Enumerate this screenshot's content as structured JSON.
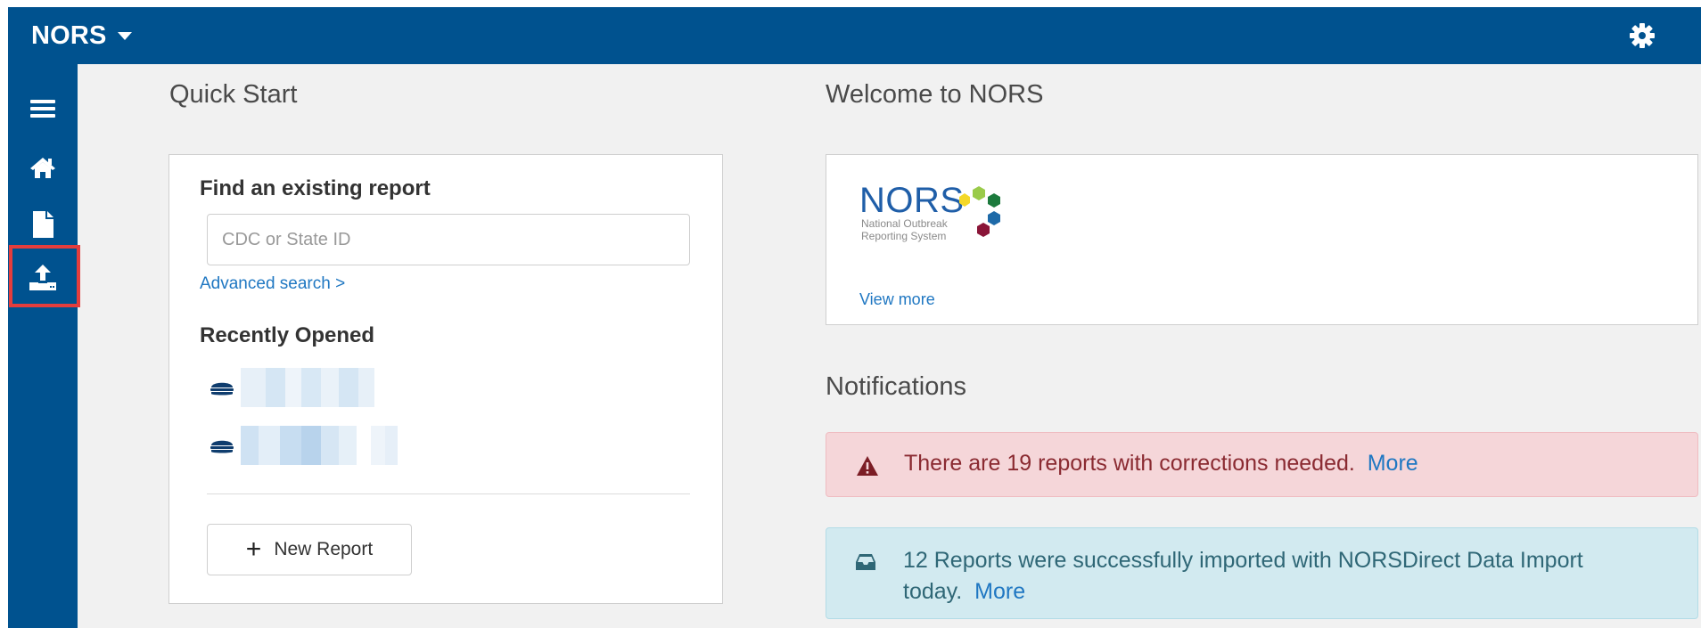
{
  "app": {
    "brand": "NORS"
  },
  "quick_start": {
    "title": "Quick Start",
    "find_heading": "Find an existing report",
    "search_placeholder": "CDC or State ID",
    "search_value": "",
    "advanced_link": "Advanced search >",
    "recent_heading": "Recently Opened",
    "new_report_label": "New Report"
  },
  "welcome": {
    "title": "Welcome to NORS",
    "logo_word": "NORS",
    "logo_line1": "National Outbreak",
    "logo_line2": "Reporting System",
    "view_more": "View more"
  },
  "notifications": {
    "title": "Notifications",
    "corrections_text": "There are 19 reports with corrections needed.",
    "corrections_more": "More",
    "import_line1": "12 Reports were successfully imported with NORSDirect Data Import",
    "import_line2": "today.",
    "import_more": "More"
  },
  "icons": {
    "sidebar": [
      "menu-icon",
      "home-icon",
      "document-icon",
      "upload-icon"
    ],
    "topbar": [
      "gear-icon"
    ],
    "recent": [
      "foodborne-icon"
    ]
  },
  "colors": {
    "brand_blue": "#00528f",
    "background": "#f1f1f1",
    "link": "#1f77c2",
    "highlight_red": "#e43d3d",
    "danger_bg": "#f5d6d9",
    "danger_text": "#8a2a31",
    "info_bg": "#d2eaf0",
    "info_text": "#2f6776"
  }
}
